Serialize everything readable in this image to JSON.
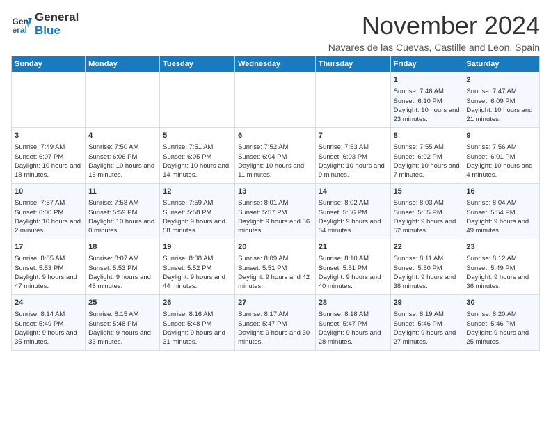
{
  "logo": {
    "line1": "General",
    "line2": "Blue"
  },
  "title": "November 2024",
  "subtitle": "Navares de las Cuevas, Castille and Leon, Spain",
  "headers": [
    "Sunday",
    "Monday",
    "Tuesday",
    "Wednesday",
    "Thursday",
    "Friday",
    "Saturday"
  ],
  "weeks": [
    [
      {
        "day": "",
        "info": ""
      },
      {
        "day": "",
        "info": ""
      },
      {
        "day": "",
        "info": ""
      },
      {
        "day": "",
        "info": ""
      },
      {
        "day": "",
        "info": ""
      },
      {
        "day": "1",
        "info": "Sunrise: 7:46 AM\nSunset: 6:10 PM\nDaylight: 10 hours and 23 minutes."
      },
      {
        "day": "2",
        "info": "Sunrise: 7:47 AM\nSunset: 6:09 PM\nDaylight: 10 hours and 21 minutes."
      }
    ],
    [
      {
        "day": "3",
        "info": "Sunrise: 7:49 AM\nSunset: 6:07 PM\nDaylight: 10 hours and 18 minutes."
      },
      {
        "day": "4",
        "info": "Sunrise: 7:50 AM\nSunset: 6:06 PM\nDaylight: 10 hours and 16 minutes."
      },
      {
        "day": "5",
        "info": "Sunrise: 7:51 AM\nSunset: 6:05 PM\nDaylight: 10 hours and 14 minutes."
      },
      {
        "day": "6",
        "info": "Sunrise: 7:52 AM\nSunset: 6:04 PM\nDaylight: 10 hours and 11 minutes."
      },
      {
        "day": "7",
        "info": "Sunrise: 7:53 AM\nSunset: 6:03 PM\nDaylight: 10 hours and 9 minutes."
      },
      {
        "day": "8",
        "info": "Sunrise: 7:55 AM\nSunset: 6:02 PM\nDaylight: 10 hours and 7 minutes."
      },
      {
        "day": "9",
        "info": "Sunrise: 7:56 AM\nSunset: 6:01 PM\nDaylight: 10 hours and 4 minutes."
      }
    ],
    [
      {
        "day": "10",
        "info": "Sunrise: 7:57 AM\nSunset: 6:00 PM\nDaylight: 10 hours and 2 minutes."
      },
      {
        "day": "11",
        "info": "Sunrise: 7:58 AM\nSunset: 5:59 PM\nDaylight: 10 hours and 0 minutes."
      },
      {
        "day": "12",
        "info": "Sunrise: 7:59 AM\nSunset: 5:58 PM\nDaylight: 9 hours and 58 minutes."
      },
      {
        "day": "13",
        "info": "Sunrise: 8:01 AM\nSunset: 5:57 PM\nDaylight: 9 hours and 56 minutes."
      },
      {
        "day": "14",
        "info": "Sunrise: 8:02 AM\nSunset: 5:56 PM\nDaylight: 9 hours and 54 minutes."
      },
      {
        "day": "15",
        "info": "Sunrise: 8:03 AM\nSunset: 5:55 PM\nDaylight: 9 hours and 52 minutes."
      },
      {
        "day": "16",
        "info": "Sunrise: 8:04 AM\nSunset: 5:54 PM\nDaylight: 9 hours and 49 minutes."
      }
    ],
    [
      {
        "day": "17",
        "info": "Sunrise: 8:05 AM\nSunset: 5:53 PM\nDaylight: 9 hours and 47 minutes."
      },
      {
        "day": "18",
        "info": "Sunrise: 8:07 AM\nSunset: 5:53 PM\nDaylight: 9 hours and 46 minutes."
      },
      {
        "day": "19",
        "info": "Sunrise: 8:08 AM\nSunset: 5:52 PM\nDaylight: 9 hours and 44 minutes."
      },
      {
        "day": "20",
        "info": "Sunrise: 8:09 AM\nSunset: 5:51 PM\nDaylight: 9 hours and 42 minutes."
      },
      {
        "day": "21",
        "info": "Sunrise: 8:10 AM\nSunset: 5:51 PM\nDaylight: 9 hours and 40 minutes."
      },
      {
        "day": "22",
        "info": "Sunrise: 8:11 AM\nSunset: 5:50 PM\nDaylight: 9 hours and 38 minutes."
      },
      {
        "day": "23",
        "info": "Sunrise: 8:12 AM\nSunset: 5:49 PM\nDaylight: 9 hours and 36 minutes."
      }
    ],
    [
      {
        "day": "24",
        "info": "Sunrise: 8:14 AM\nSunset: 5:49 PM\nDaylight: 9 hours and 35 minutes."
      },
      {
        "day": "25",
        "info": "Sunrise: 8:15 AM\nSunset: 5:48 PM\nDaylight: 9 hours and 33 minutes."
      },
      {
        "day": "26",
        "info": "Sunrise: 8:16 AM\nSunset: 5:48 PM\nDaylight: 9 hours and 31 minutes."
      },
      {
        "day": "27",
        "info": "Sunrise: 8:17 AM\nSunset: 5:47 PM\nDaylight: 9 hours and 30 minutes."
      },
      {
        "day": "28",
        "info": "Sunrise: 8:18 AM\nSunset: 5:47 PM\nDaylight: 9 hours and 28 minutes."
      },
      {
        "day": "29",
        "info": "Sunrise: 8:19 AM\nSunset: 5:46 PM\nDaylight: 9 hours and 27 minutes."
      },
      {
        "day": "30",
        "info": "Sunrise: 8:20 AM\nSunset: 5:46 PM\nDaylight: 9 hours and 25 minutes."
      }
    ]
  ]
}
